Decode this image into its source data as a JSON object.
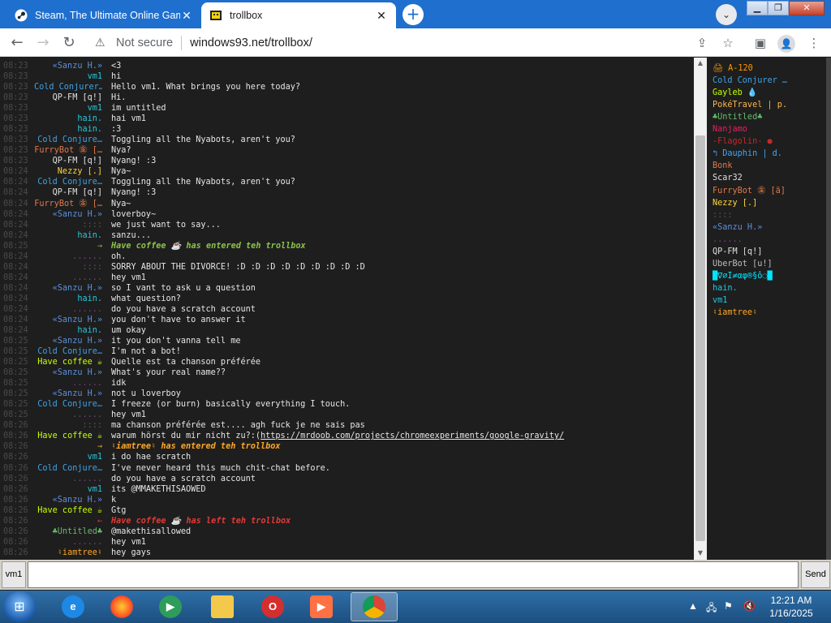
{
  "browser": {
    "tabs": [
      {
        "title": "Steam, The Ultimate Online Gam",
        "close": "✕"
      },
      {
        "title": "trollbox",
        "close": "✕"
      }
    ],
    "new_tab": "+",
    "tab_search_icon": "⌄",
    "security_icon": "⚠",
    "security_label": "Not secure",
    "url": "windows93.net/trollbox/"
  },
  "chat": {
    "messages": [
      {
        "time": "08:23",
        "nick": "«Sanzu H.»",
        "color": "#5d8fd8",
        "text": "<3",
        "sys": false
      },
      {
        "time": "08:23",
        "nick": "vm1",
        "color": "#26c6da",
        "text": "hi",
        "sys": false
      },
      {
        "time": "08:23",
        "nick": "Cold Conjurer…",
        "color": "#3fa3e6",
        "text": "Hello vm1. What brings you here today?",
        "sys": false
      },
      {
        "time": "08:23",
        "nick": "QP-FM [q!]",
        "color": "#e0e0e0",
        "text": "Hi.",
        "sys": false
      },
      {
        "time": "08:23",
        "nick": "vm1",
        "color": "#26c6da",
        "text": "im untitled",
        "sys": false
      },
      {
        "time": "08:23",
        "nick": "hain.",
        "color": "#26c6da",
        "text": "hai vm1",
        "sys": false
      },
      {
        "time": "08:23",
        "nick": "hain.",
        "color": "#26c6da",
        "text": ":3",
        "sys": false
      },
      {
        "time": "08:23",
        "nick": "Cold Conjure…",
        "color": "#3fa3e6",
        "text": "Toggling all the Nyabots, aren't you?",
        "sys": false
      },
      {
        "time": "08:23",
        "nick": "FurryBot ㊎ […",
        "color": "#e0794a",
        "text": "Nya?",
        "sys": false
      },
      {
        "time": "08:23",
        "nick": "QP-FM [q!]",
        "color": "#e0e0e0",
        "text": "Nyang! :3",
        "sys": false
      },
      {
        "time": "08:24",
        "nick": "Nezzy [.]",
        "color": "#ffd43b",
        "text": "Nya~",
        "sys": false
      },
      {
        "time": "08:24",
        "nick": "Cold Conjure…",
        "color": "#3fa3e6",
        "text": "Toggling all the Nyabots, aren't you?",
        "sys": false
      },
      {
        "time": "08:24",
        "nick": "QP-FM [q!]",
        "color": "#e0e0e0",
        "text": "Nyang! :3",
        "sys": false
      },
      {
        "time": "08:24",
        "nick": "FurryBot ㊎ […",
        "color": "#e0794a",
        "text": "Nya~",
        "sys": false
      },
      {
        "time": "08:24",
        "nick": "«Sanzu H.»",
        "color": "#5d8fd8",
        "text": "loverboy~",
        "sys": false
      },
      {
        "time": "08:24",
        "nick": "::::",
        "color": "#555555",
        "text": "we just want to say...",
        "sys": false
      },
      {
        "time": "08:24",
        "nick": "hain.",
        "color": "#26c6da",
        "text": "sanzu...",
        "sys": false
      },
      {
        "time": "08:25",
        "nick": "→",
        "color": "#8bc34a",
        "text": "Have coffee ☕ has entered teh trollbox",
        "sys": true
      },
      {
        "time": "08:24",
        "nick": "......",
        "color": "#7e3f8c",
        "text": "oh.",
        "sys": false
      },
      {
        "time": "08:24",
        "nick": "::::",
        "color": "#555555",
        "text": "SORRY ABOUT THE DIVORCE! :D :D :D :D :D :D :D :D :D",
        "sys": false
      },
      {
        "time": "08:24",
        "nick": "......",
        "color": "#7e3f8c",
        "text": "hey vm1",
        "sys": false
      },
      {
        "time": "08:24",
        "nick": "«Sanzu H.»",
        "color": "#5d8fd8",
        "text": "so I vant to ask u a question",
        "sys": false
      },
      {
        "time": "08:24",
        "nick": "hain.",
        "color": "#26c6da",
        "text": "what question?",
        "sys": false
      },
      {
        "time": "08:24",
        "nick": "......",
        "color": "#7e3f8c",
        "text": "do you have a scratch account",
        "sys": false
      },
      {
        "time": "08:24",
        "nick": "«Sanzu H.»",
        "color": "#5d8fd8",
        "text": "you don't have to answer it",
        "sys": false
      },
      {
        "time": "08:24",
        "nick": "hain.",
        "color": "#26c6da",
        "text": "um okay",
        "sys": false
      },
      {
        "time": "08:25",
        "nick": "«Sanzu H.»",
        "color": "#5d8fd8",
        "text": "it you don't vanna tell me",
        "sys": false
      },
      {
        "time": "08:25",
        "nick": "Cold Conjure…",
        "color": "#3fa3e6",
        "text": "I'm not a bot!",
        "sys": false
      },
      {
        "time": "08:25",
        "nick": "Have coffee ☕",
        "color": "#c6ff00",
        "text": "Quelle est ta chanson préférée",
        "sys": false
      },
      {
        "time": "08:25",
        "nick": "«Sanzu H.»",
        "color": "#5d8fd8",
        "text": "What's your real name??",
        "sys": false
      },
      {
        "time": "08:25",
        "nick": "......",
        "color": "#7e3f8c",
        "text": "idk",
        "sys": false
      },
      {
        "time": "08:25",
        "nick": "«Sanzu H.»",
        "color": "#5d8fd8",
        "text": "not u loverboy",
        "sys": false
      },
      {
        "time": "08:25",
        "nick": "Cold Conjure…",
        "color": "#3fa3e6",
        "text": "I freeze (or burn) basically everything I touch.",
        "sys": false
      },
      {
        "time": "08:25",
        "nick": "......",
        "color": "#7e3f8c",
        "text": "hey vm1",
        "sys": false
      },
      {
        "time": "08:26",
        "nick": "::::",
        "color": "#555555",
        "text": "ma chanson préférée est.... agh fuck je ne sais pas",
        "sys": false
      },
      {
        "time": "08:26",
        "nick": "Have coffee ☕",
        "color": "#c6ff00",
        "text": "warum hörst du mir nicht zu?:(",
        "link": "https://mrdoob.com/projects/chromeexperiments/google-gravity/",
        "sys": false
      },
      {
        "time": "08:26",
        "nick": "→",
        "color": "#ffa726",
        "text": "♮iamtree♮ has entered teh trollbox",
        "sys": true
      },
      {
        "time": "08:26",
        "nick": "vm1",
        "color": "#26c6da",
        "text": "i do hae scratch",
        "sys": false
      },
      {
        "time": "08:26",
        "nick": "Cold Conjure…",
        "color": "#3fa3e6",
        "text": "I've never heard this much chit-chat before.",
        "sys": false
      },
      {
        "time": "08:26",
        "nick": "......",
        "color": "#7e3f8c",
        "text": "do you have a scratch account",
        "sys": false
      },
      {
        "time": "08:26",
        "nick": "vm1",
        "color": "#26c6da",
        "text": "its @MMAKETHISAOWED",
        "sys": false
      },
      {
        "time": "08:26",
        "nick": "«Sanzu H.»",
        "color": "#5d8fd8",
        "text": "k",
        "sys": false
      },
      {
        "time": "08:26",
        "nick": "Have coffee ☕",
        "color": "#c6ff00",
        "text": "Gtg",
        "sys": false
      },
      {
        "time": "08:26",
        "nick": "←",
        "color": "#e53935",
        "text": "Have coffee ☕ has left teh trollbox",
        "sys": true
      },
      {
        "time": "08:26",
        "nick": "♣Untitled♣",
        "color": "#66bb6a",
        "text": "@makethisallowed",
        "sys": false
      },
      {
        "time": "08:26",
        "nick": "......",
        "color": "#7e3f8c",
        "text": "hey vm1",
        "sys": false
      },
      {
        "time": "08:26",
        "nick": "♮iamtree♮",
        "color": "#ffa726",
        "text": "hey gays",
        "sys": false
      }
    ]
  },
  "users": [
    {
      "name": "🖨 A-120",
      "color": "#ff9800"
    },
    {
      "name": "Cold Conjurer …",
      "color": "#3fa3e6"
    },
    {
      "name": "Gayleb 💧",
      "color": "#c6ff00"
    },
    {
      "name": "PokéTravel | p.",
      "color": "#ffb74d"
    },
    {
      "name": "♣Untitled♣",
      "color": "#66bb6a"
    },
    {
      "name": "Nanjamo",
      "color": "#e91e63"
    },
    {
      "name": "-Flagolin- ●",
      "color": "#c62828"
    },
    {
      "name": "↰ Dauphin | d.",
      "color": "#42a5f5"
    },
    {
      "name": "Bonk",
      "color": "#e0794a"
    },
    {
      "name": "Scar32",
      "color": "#e0e0e0"
    },
    {
      "name": "FurryBot ㊎ [ä]",
      "color": "#e0794a"
    },
    {
      "name": "Nezzy [.]",
      "color": "#ffd43b"
    },
    {
      "name": "::::",
      "color": "#555555"
    },
    {
      "name": "«Sanzu H.»",
      "color": "#5d8fd8"
    },
    {
      "name": "......",
      "color": "#7e3f8c"
    },
    {
      "name": "QP-FM [q!]",
      "color": "#e0e0e0"
    },
    {
      "name": "UberBot [u!]",
      "color": "#bdbdbd"
    },
    {
      "name": "█∇∅Ι≠αφ®§ô◌█",
      "color": "#00e5ff"
    },
    {
      "name": "hain.",
      "color": "#26c6da"
    },
    {
      "name": "vm1",
      "color": "#26c6da"
    },
    {
      "name": "♮iamtree♮",
      "color": "#ffa726"
    }
  ],
  "input": {
    "nick": "vm1",
    "placeholder": "",
    "send_label": "Send"
  },
  "taskbar": {
    "time": "12:21 AM",
    "date": "1/16/2025"
  }
}
